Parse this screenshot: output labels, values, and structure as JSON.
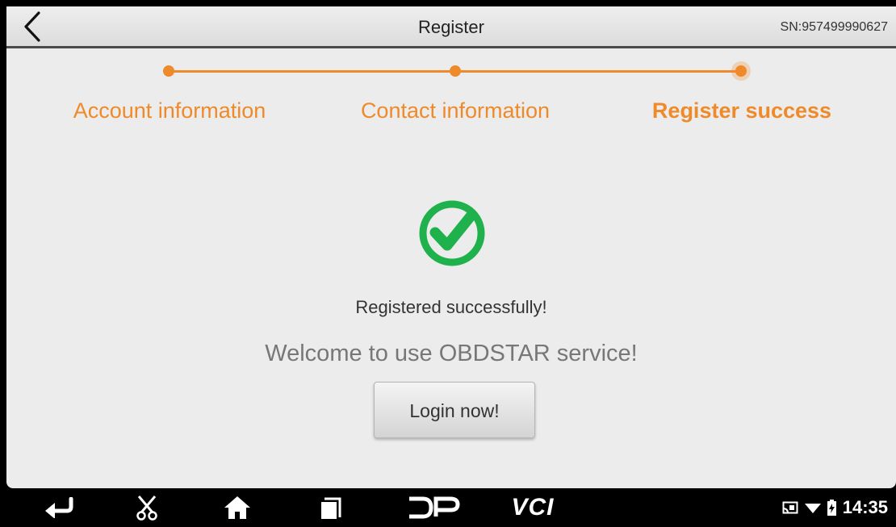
{
  "header": {
    "title": "Register",
    "serial": "SN:957499990627",
    "back_icon": "chevron-left-icon"
  },
  "stepper": {
    "steps": [
      {
        "label": "Account information",
        "state": "done"
      },
      {
        "label": "Contact information",
        "state": "done"
      },
      {
        "label": "Register success",
        "state": "active"
      }
    ],
    "accent_color": "#ef8a2a"
  },
  "result": {
    "icon": "check-circle-icon",
    "icon_color": "#1fb14b",
    "title": "Registered successfully!",
    "message": "Welcome to use OBDSTAR service!",
    "login_button": "Login now!"
  },
  "navbar": {
    "buttons": [
      "back-arrow-icon",
      "scissors-icon",
      "home-icon",
      "recent-apps-icon",
      "dp-logo-icon",
      "vci-logo-icon"
    ],
    "dp_label": "DP",
    "vci_label": "VCI",
    "status_icons": [
      "cast-icon",
      "wifi-icon",
      "battery-icon"
    ],
    "time": "14:35"
  }
}
